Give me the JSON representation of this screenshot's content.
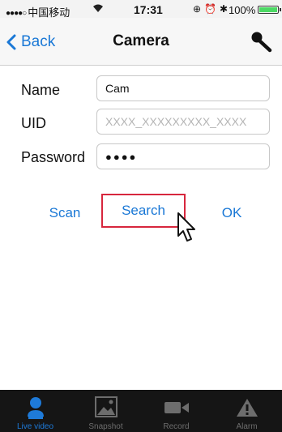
{
  "status_bar": {
    "carrier": "中国移动",
    "time": "17:31",
    "battery": "100%"
  },
  "nav": {
    "back_label": "Back",
    "title": "Camera"
  },
  "form": {
    "name_label": "Name",
    "name_value": "Cam",
    "uid_label": "UID",
    "uid_placeholder": "XXXX_XXXXXXXXX_XXXX",
    "password_label": "Password",
    "password_mask": "●●●●"
  },
  "actions": {
    "scan_label": "Scan",
    "search_label": "Search",
    "ok_label": "OK"
  },
  "tabs": [
    {
      "label": "Live video",
      "icon": "person-icon",
      "active": true
    },
    {
      "label": "Snapshot",
      "icon": "image-icon",
      "active": false
    },
    {
      "label": "Record",
      "icon": "video-camera-icon",
      "active": false
    },
    {
      "label": "Alarm",
      "icon": "warning-icon",
      "active": false
    }
  ],
  "colors": {
    "accent": "#1a78d6",
    "highlight_border": "#d7263d",
    "tab_bar": "#151515",
    "active_tab": "#1e7ad8"
  }
}
